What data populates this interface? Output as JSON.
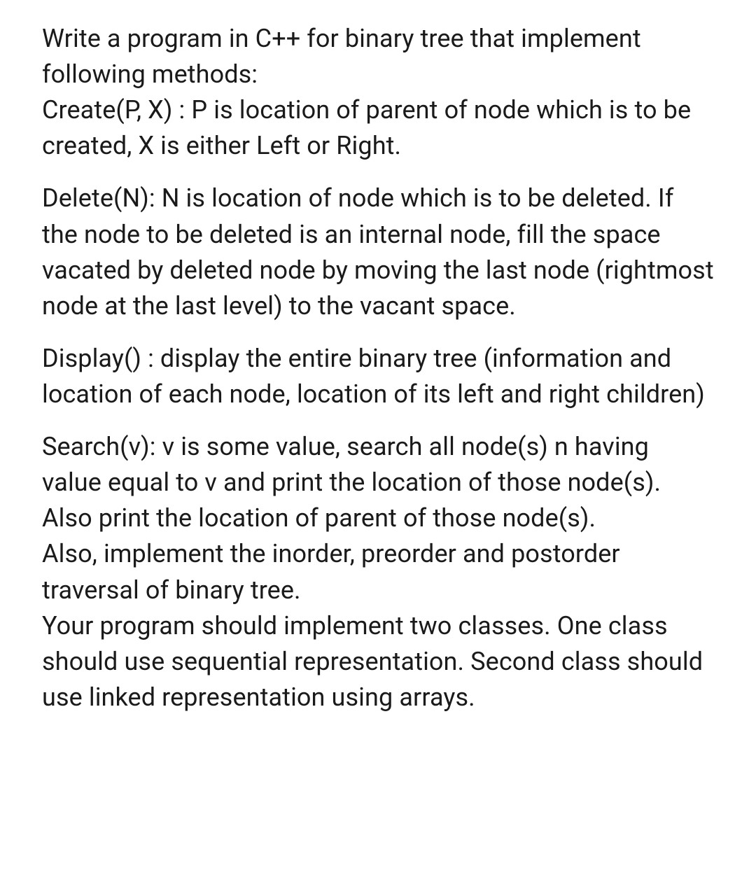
{
  "paragraphs": [
    "Write a program in C++ for binary tree that implement following methods:\nCreate(P, X) : P is location of parent of node which is to be created, X is either Left or Right.",
    "Delete(N): N is location of node which is to be deleted. If the node to be deleted is an internal node, fill the space vacated by deleted node by moving the last node (rightmost node at the last level) to the vacant space.",
    "Display() : display the entire binary tree (information and location of each node, location of its left and right children)",
    "Search(v): v is some value, search all node(s) n having value equal to v and print the location of those node(s). Also print the location of parent of those node(s).\nAlso, implement the inorder, preorder and postorder traversal of binary tree.\nYour program should implement two classes. One class should use sequential representation. Second class should use linked representation using arrays."
  ]
}
